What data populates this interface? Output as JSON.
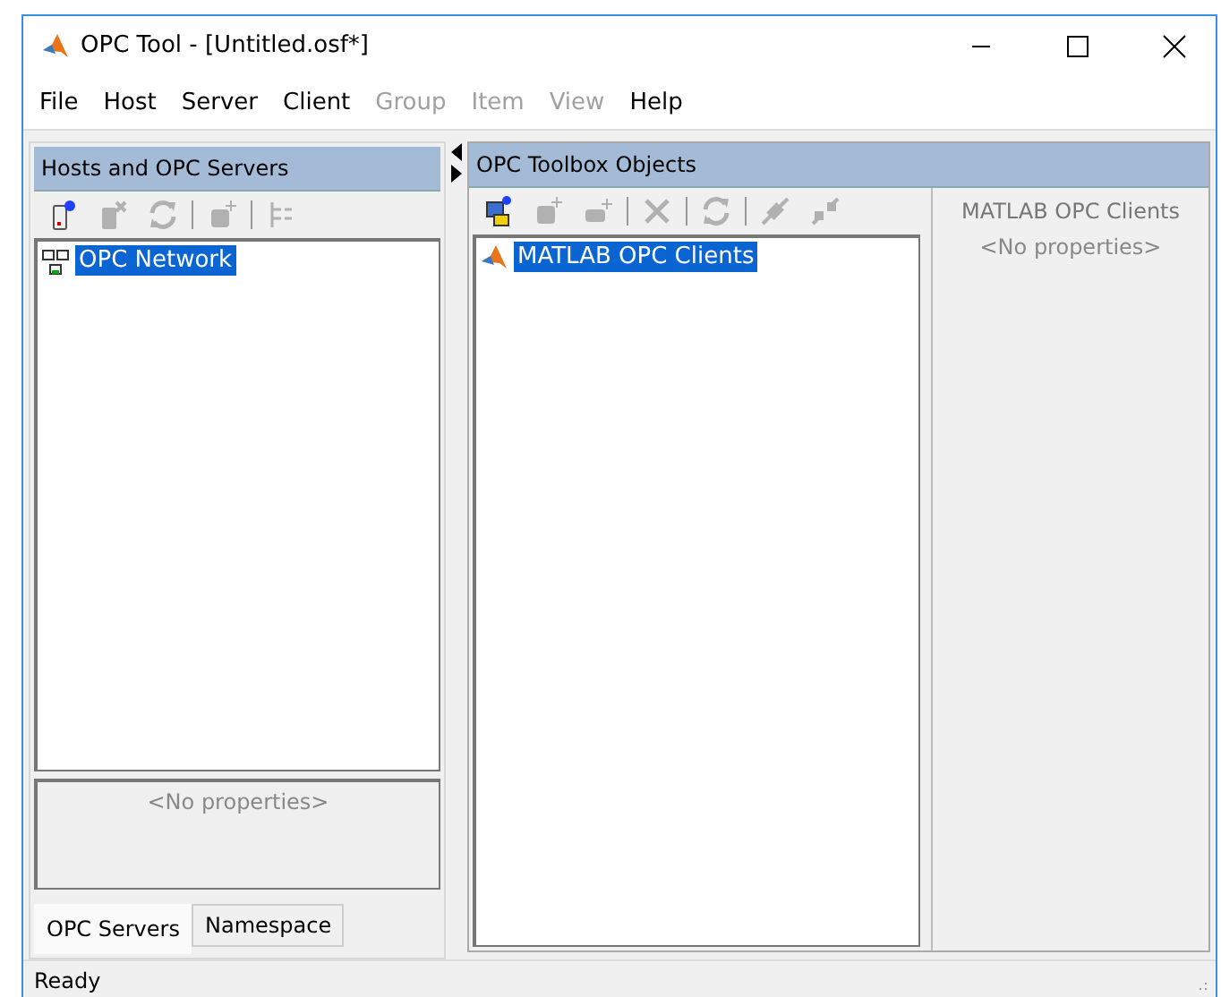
{
  "window": {
    "title": "OPC Tool - [Untitled.osf*]"
  },
  "menu": [
    {
      "label": "File",
      "disabled": false
    },
    {
      "label": "Host",
      "disabled": false
    },
    {
      "label": "Server",
      "disabled": false
    },
    {
      "label": "Client",
      "disabled": false
    },
    {
      "label": "Group",
      "disabled": true
    },
    {
      "label": "Item",
      "disabled": true
    },
    {
      "label": "View",
      "disabled": true
    },
    {
      "label": "Help",
      "disabled": false
    }
  ],
  "left_panel": {
    "title": "Hosts and OPC Servers",
    "toolbar": [
      {
        "kind": "server-add",
        "disabled": false
      },
      {
        "kind": "server-remove",
        "disabled": true
      },
      {
        "kind": "refresh",
        "disabled": true
      },
      {
        "kind": "separator"
      },
      {
        "kind": "group-add",
        "disabled": true
      },
      {
        "kind": "separator"
      },
      {
        "kind": "tree",
        "disabled": true
      }
    ],
    "tree": [
      {
        "label": "OPC Network",
        "selected": true
      }
    ],
    "properties": "<No properties>",
    "tabs": [
      {
        "label": "OPC Servers",
        "selected": true
      },
      {
        "label": "Namespace",
        "selected": false
      }
    ]
  },
  "right_panel": {
    "title": "OPC Toolbox Objects",
    "toolbar": [
      {
        "kind": "client-add",
        "disabled": false
      },
      {
        "kind": "group-add",
        "disabled": true
      },
      {
        "kind": "item-add",
        "disabled": true
      },
      {
        "kind": "separator"
      },
      {
        "kind": "delete",
        "disabled": true
      },
      {
        "kind": "separator"
      },
      {
        "kind": "refresh",
        "disabled": true
      },
      {
        "kind": "separator"
      },
      {
        "kind": "connect",
        "disabled": true
      },
      {
        "kind": "disconnect",
        "disabled": true
      }
    ],
    "tree": [
      {
        "label": "MATLAB OPC Clients",
        "selected": true
      }
    ],
    "properties_title": "MATLAB OPC Clients",
    "properties": "<No properties>"
  },
  "status_bar": "Ready"
}
